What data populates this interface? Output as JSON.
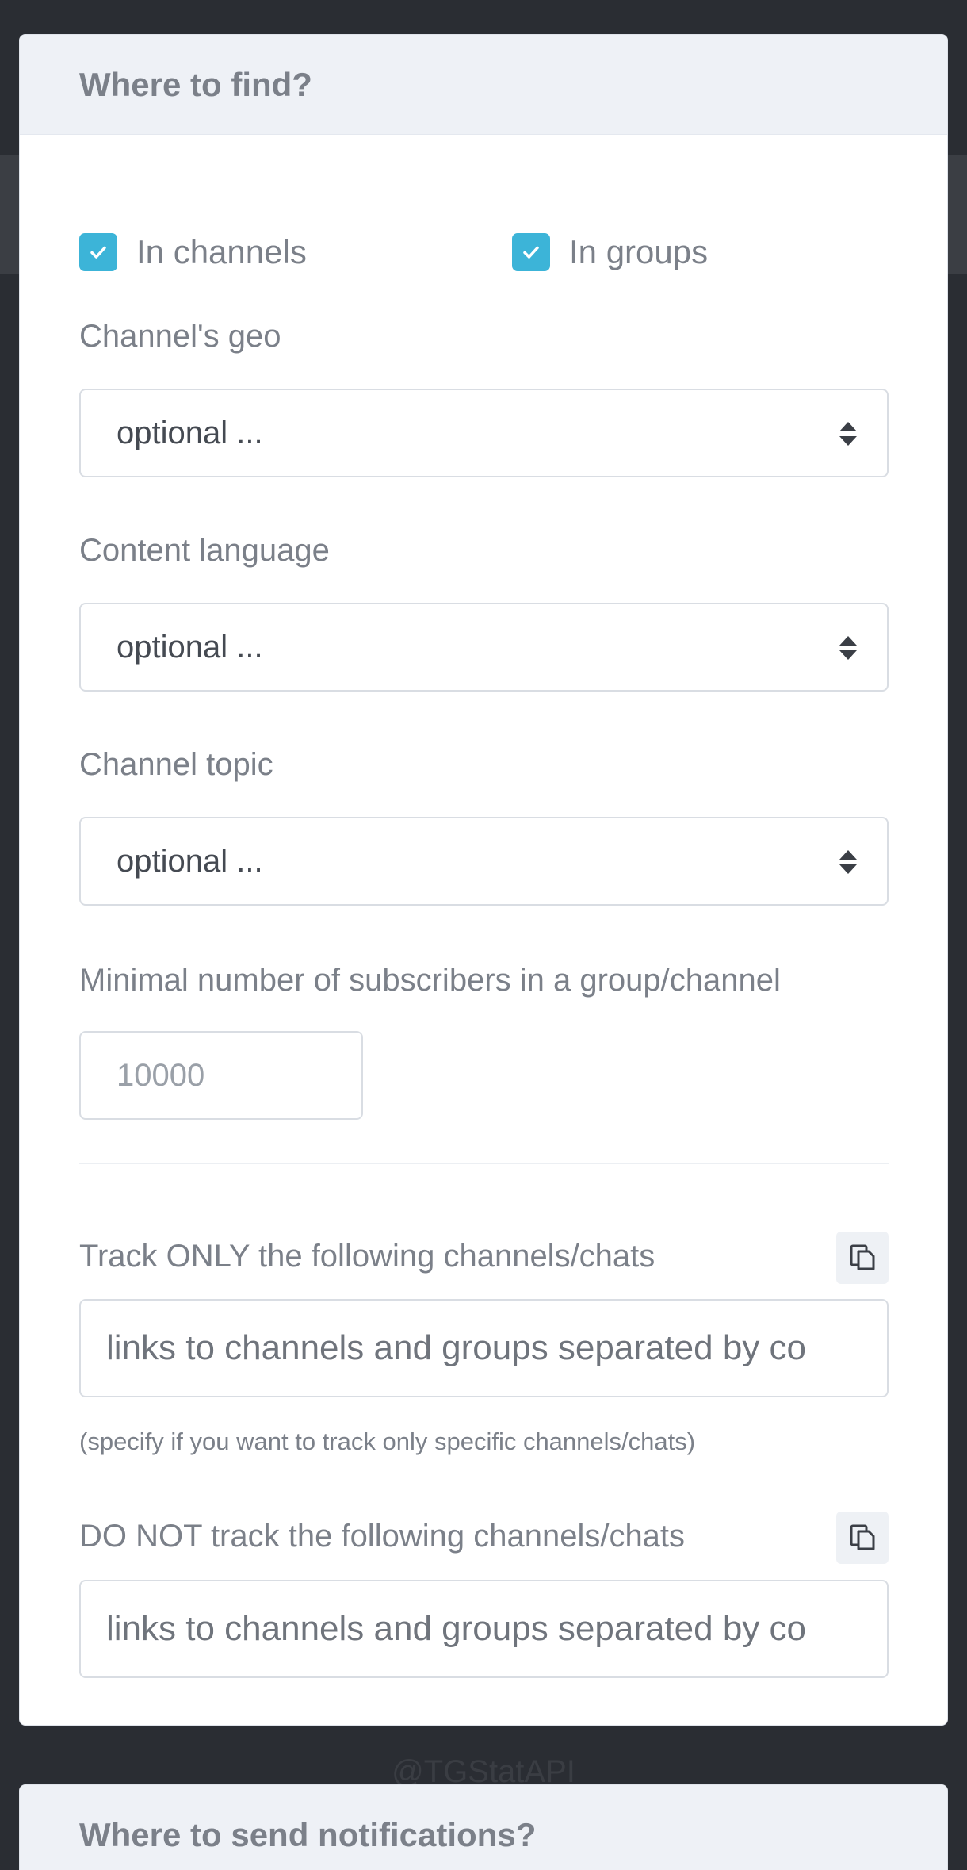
{
  "where_to_find": {
    "title": "Where to find?",
    "in_channels": {
      "label": "In channels",
      "checked": true
    },
    "in_groups": {
      "label": "In groups",
      "checked": true
    },
    "channel_geo": {
      "label": "Channel's geo",
      "value": "optional ..."
    },
    "content_language": {
      "label": "Content language",
      "value": "optional ..."
    },
    "channel_topic": {
      "label": "Channel topic",
      "value": "optional ..."
    },
    "min_subscribers": {
      "label": "Minimal number of subscribers in a group/channel",
      "placeholder": "10000"
    },
    "track_only": {
      "label": "Track ONLY the following channels/chats",
      "placeholder": "links to channels and groups separated by co",
      "help": "(specify if you want to track only specific channels/chats)"
    },
    "do_not_track": {
      "label": "DO NOT track the following channels/chats",
      "placeholder": "links to channels and groups separated by co"
    }
  },
  "watermark": "@TGStatAPI",
  "where_to_send": {
    "title": "Where to send notifications?"
  },
  "colors": {
    "accent": "#3cb4d8",
    "label": "#7b8089",
    "background": "#2a2d33"
  }
}
